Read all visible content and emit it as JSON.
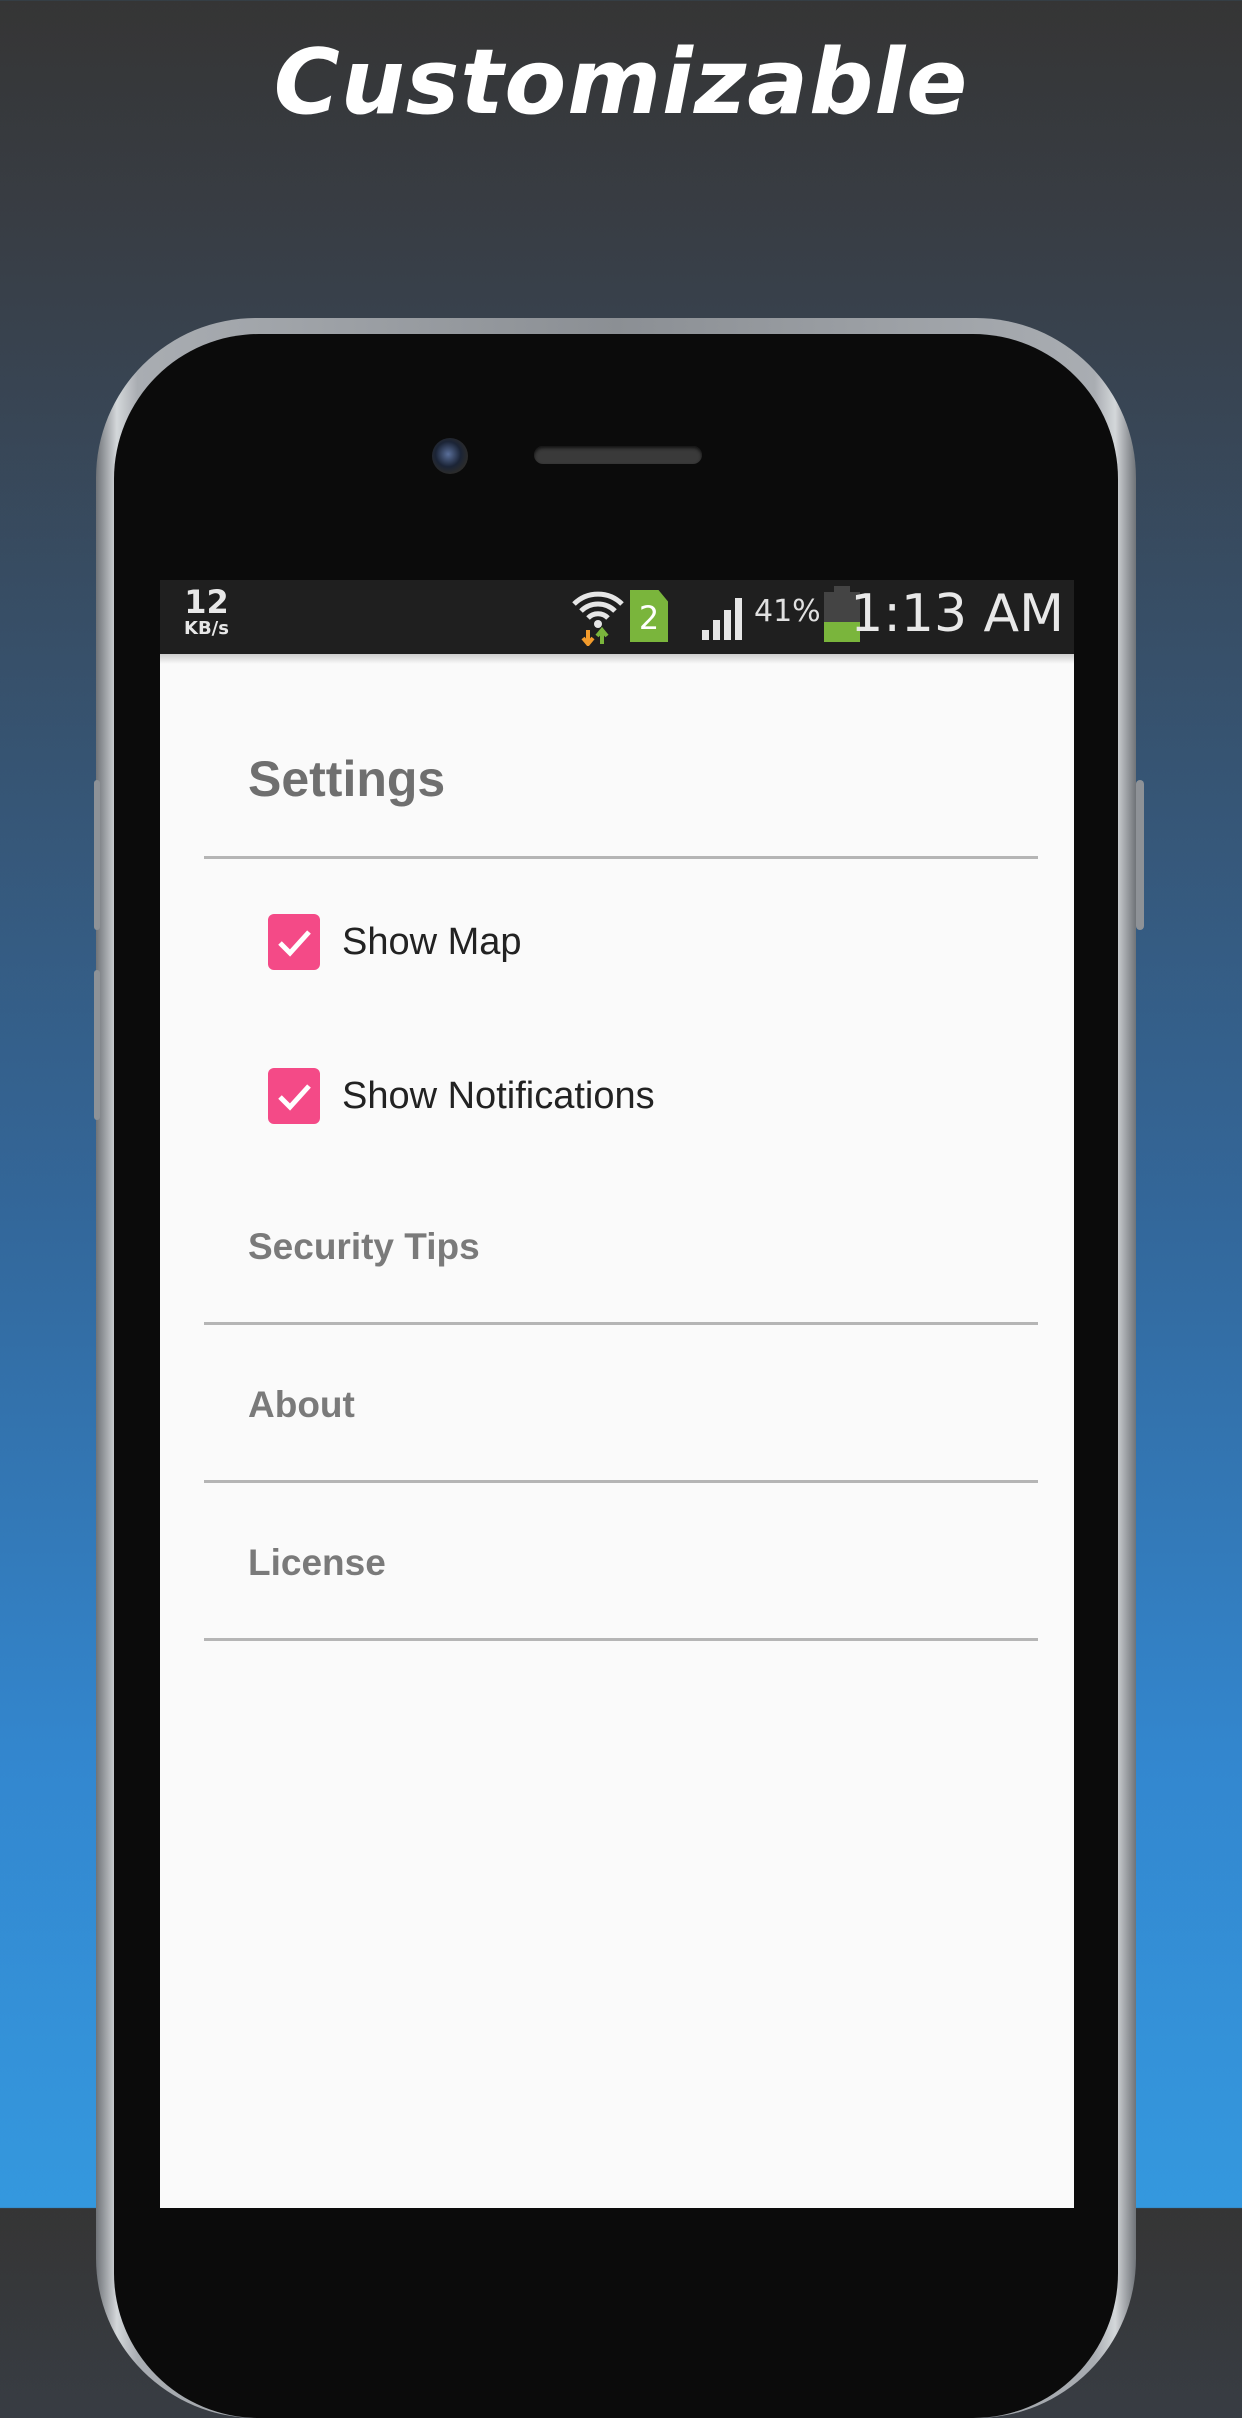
{
  "promo": {
    "title": "Customizable"
  },
  "statusbar": {
    "speed_value": "12",
    "speed_unit": "KB/s",
    "wifi_icon": "wifi-icon",
    "sim_slot": "2",
    "signal_icon": "signal-icon",
    "battery_percent": "41%",
    "battery_level": 0.41,
    "time": "1:13 AM"
  },
  "settings": {
    "title": "Settings",
    "checkboxes": [
      {
        "label": "Show Map",
        "checked": true
      },
      {
        "label": "Show Notifications",
        "checked": true
      }
    ],
    "items": [
      {
        "label": "Security Tips"
      },
      {
        "label": "About"
      },
      {
        "label": "License"
      }
    ]
  },
  "colors": {
    "accent": "#f44a87",
    "battery_green": "#7ab53c",
    "statusbar_bg": "#1f1f1f",
    "screen_bg": "#fafafa"
  }
}
